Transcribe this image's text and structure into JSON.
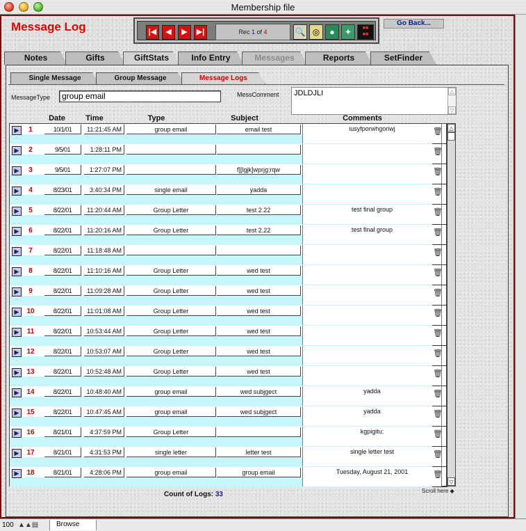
{
  "window": {
    "title": "Membership file"
  },
  "header": {
    "title": "Message Log",
    "go_back": "Go Back..."
  },
  "nav": {
    "first_label": "|◀",
    "prev_label": "◀",
    "next_label": "▶",
    "last_label": "▶|",
    "rec_prefix": "Rec",
    "rec_current": "1",
    "rec_of": "of",
    "rec_total": "4",
    "tools": [
      "magnifier-icon",
      "globe-icon",
      "earth-icon",
      "compass-icon",
      "contact-center-icon"
    ]
  },
  "main_tabs": [
    {
      "label": "Notes",
      "state": "normal"
    },
    {
      "label": "Gifts",
      "state": "normal"
    },
    {
      "label": "GiftStats",
      "state": "active"
    },
    {
      "label": "Info Entry",
      "state": "normal"
    },
    {
      "label": "Messages",
      "state": "disabled"
    },
    {
      "label": "Reports",
      "state": "normal"
    },
    {
      "label": "SetFinder",
      "state": "normal"
    }
  ],
  "sub_tabs": [
    {
      "label": "Single Message"
    },
    {
      "label": "Group Message"
    },
    {
      "label": "Message Logs"
    }
  ],
  "form": {
    "message_type_label": "MessageType",
    "message_type_value": "group email",
    "comment_label": "MessComment",
    "comment_value": "JDLDJLI"
  },
  "table": {
    "headers": {
      "date": "Date",
      "time": "Time",
      "type": "Type",
      "subject": "Subject",
      "comments": "Comments"
    },
    "rows": [
      {
        "num": "1",
        "date": "10/1/01",
        "time": "11:21:45 AM",
        "type": "group email",
        "subject": "email test",
        "comment": "iusyfporwhgoriwj"
      },
      {
        "num": "2",
        "date": "9/5/01",
        "time": "1:28:11 PM",
        "type": "",
        "subject": "",
        "comment": ""
      },
      {
        "num": "3",
        "date": "9/5/01",
        "time": "1:27:07 PM",
        "type": "",
        "subject": "f][lgjk]wprjg;rqw",
        "comment": ""
      },
      {
        "num": "4",
        "date": "8/23/01",
        "time": "3:40:34 PM",
        "type": "single email",
        "subject": "yadda",
        "comment": ""
      },
      {
        "num": "5",
        "date": "8/22/01",
        "time": "11:20:44 AM",
        "type": "Group Letter",
        "subject": "test 2.22",
        "comment": "test final group"
      },
      {
        "num": "6",
        "date": "8/22/01",
        "time": "11:20:16 AM",
        "type": "Group Letter",
        "subject": "test 2.22",
        "comment": "test final group"
      },
      {
        "num": "7",
        "date": "8/22/01",
        "time": "11:18:48 AM",
        "type": "",
        "subject": "",
        "comment": ""
      },
      {
        "num": "8",
        "date": "8/22/01",
        "time": "11:10:16 AM",
        "type": "Group Letter",
        "subject": "wed test",
        "comment": ""
      },
      {
        "num": "9",
        "date": "8/22/01",
        "time": "11:09:28 AM",
        "type": "Group Letter",
        "subject": "wed test",
        "comment": ""
      },
      {
        "num": "10",
        "date": "8/22/01",
        "time": "11:01:08 AM",
        "type": "Group Letter",
        "subject": "wed test",
        "comment": ""
      },
      {
        "num": "11",
        "date": "8/22/01",
        "time": "10:53:44 AM",
        "type": "Group Letter",
        "subject": "wed test",
        "comment": ""
      },
      {
        "num": "12",
        "date": "8/22/01",
        "time": "10:53:07 AM",
        "type": "Group Letter",
        "subject": "wed test",
        "comment": ""
      },
      {
        "num": "13",
        "date": "8/22/01",
        "time": "10:52:48 AM",
        "type": "Group Letter",
        "subject": "wed test",
        "comment": ""
      },
      {
        "num": "14",
        "date": "8/22/01",
        "time": "10:48:40 AM",
        "type": "group email",
        "subject": "wed subjgect",
        "comment": "yadda"
      },
      {
        "num": "15",
        "date": "8/22/01",
        "time": "10:47:45 AM",
        "type": "group email",
        "subject": "wed subjgect",
        "comment": "yadda"
      },
      {
        "num": "16",
        "date": "8/21/01",
        "time": "4:37:59 PM",
        "type": "Group Letter",
        "subject": "",
        "comment": "kgpigitu;"
      },
      {
        "num": "17",
        "date": "8/21/01",
        "time": "4:31:53 PM",
        "type": "single letter",
        "subject": "letter test",
        "comment": "single letter test"
      },
      {
        "num": "18",
        "date": "8/21/01",
        "time": "4:28:06 PM",
        "type": "group email",
        "subject": "group email",
        "comment": "Tuesday, August 21, 2001"
      }
    ]
  },
  "footer": {
    "count_label": "Count of Logs:",
    "count_value": "33",
    "scroll_hint": "Scroll here"
  },
  "status": {
    "zoom": "100",
    "mode": "Browse"
  },
  "colors": {
    "accent_red": "#e00000",
    "row_band": "#c6f6fb",
    "frame": "#6e0d0d",
    "link_blue": "#0b1d8a"
  }
}
